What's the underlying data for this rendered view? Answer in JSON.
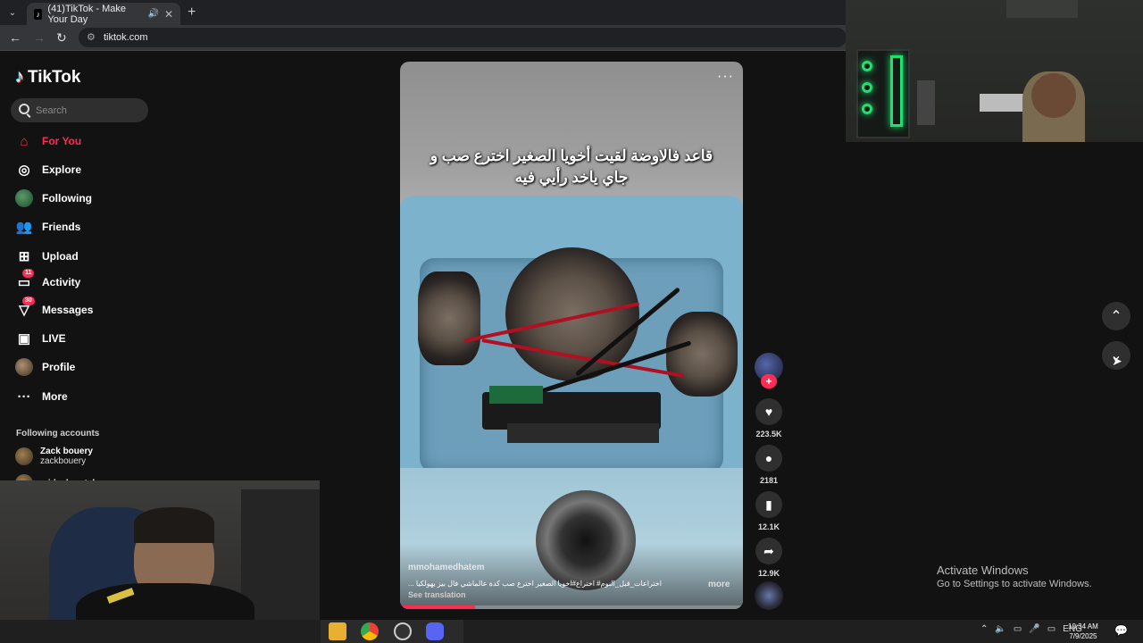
{
  "browser": {
    "tab_title": "(41)TikTok - Make Your Day",
    "url": "tiktok.com"
  },
  "sidebar": {
    "logo": "TikTok",
    "search_placeholder": "Search",
    "items": [
      {
        "label": "For You",
        "icon": "home-icon",
        "active": true
      },
      {
        "label": "Explore",
        "icon": "compass-icon"
      },
      {
        "label": "Following",
        "icon": "following-avatar"
      },
      {
        "label": "Friends",
        "icon": "friends-icon"
      },
      {
        "label": "Upload",
        "icon": "upload-icon"
      },
      {
        "label": "Activity",
        "icon": "activity-icon",
        "badge": "11"
      },
      {
        "label": "Messages",
        "icon": "messages-icon",
        "badge": "30"
      },
      {
        "label": "LIVE",
        "icon": "live-icon"
      },
      {
        "label": "Profile",
        "icon": "profile-avatar"
      },
      {
        "label": "More",
        "icon": "more-icon"
      }
    ],
    "following_title": "Following accounts",
    "following": [
      {
        "name": "Zack bouery",
        "handle": "zackbouery"
      },
      {
        "name": "mideelgentel",
        "handle": ""
      }
    ]
  },
  "video": {
    "caption": "قاعد فالاوضة لقيت أخويا الصغير اخترع صب و جاي ياخد رأيي فيه",
    "author": "mmohamedhatem",
    "description": "اختراعات_قبل_النوم# اختراع#اخويا الصغير اخترع صب كدة عالماشي فال بيز يهولكيا ...",
    "see_translation": "See translation",
    "more": "more",
    "progress": 0.22
  },
  "actions": {
    "likes": "223.5K",
    "comments": "2181",
    "saves": "12.1K",
    "shares": "12.9K"
  },
  "watermark": {
    "line1": "Activate Windows",
    "line2": "Go to Settings to activate Windows."
  },
  "taskbar": {
    "lang": "ENG",
    "time": "10:34 AM",
    "date": "7/9/2025"
  },
  "colors": {
    "accent": "#fe2c55",
    "background": "#121212"
  }
}
